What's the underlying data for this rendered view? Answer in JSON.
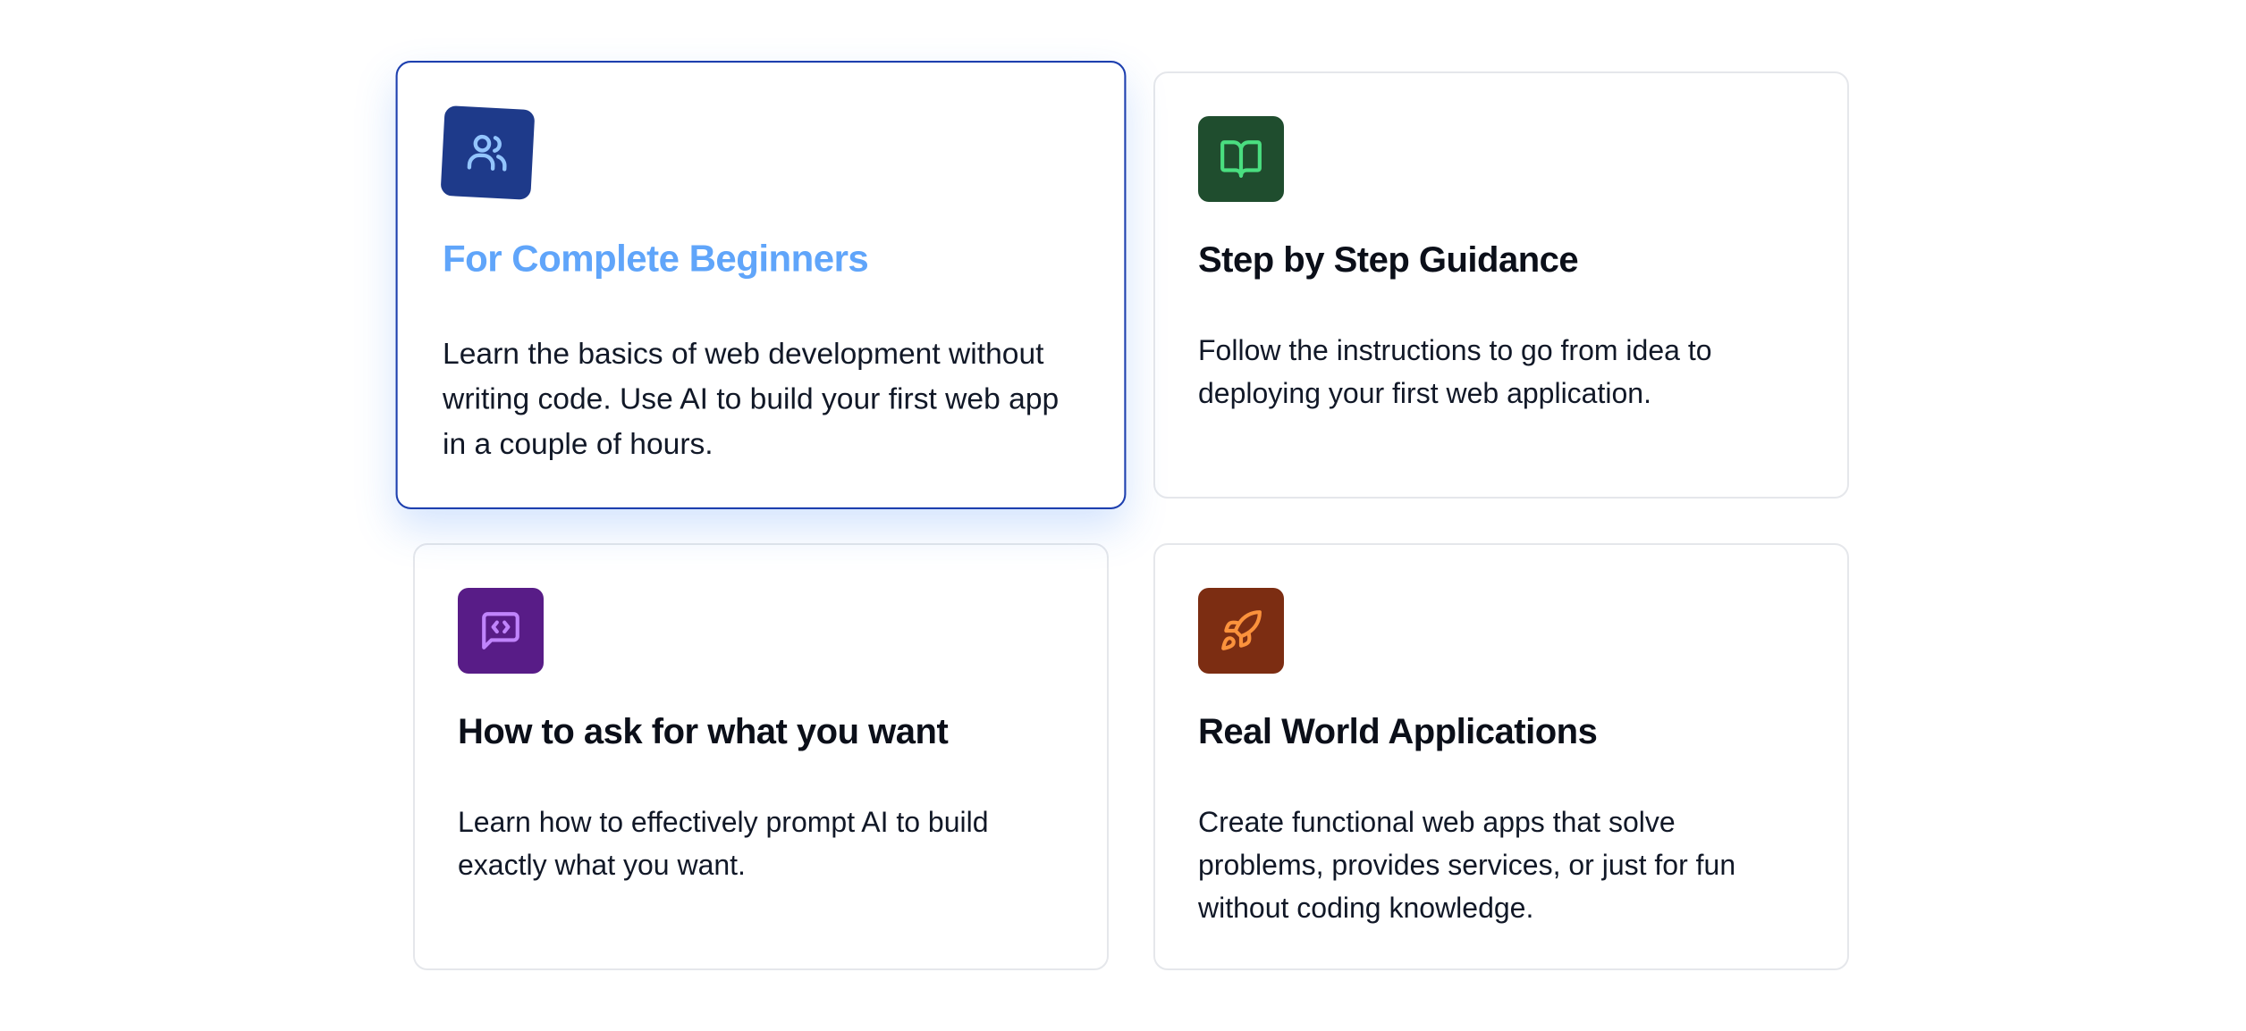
{
  "cards": [
    {
      "title": "For Complete Beginners",
      "description": "Learn the basics of web development without writing code. Use AI to build your first web app in a couple of hours.",
      "icon": "users-icon",
      "icon_bg": "#1e3a8a",
      "icon_color": "#93c5fd",
      "active": true
    },
    {
      "title": "Step by Step Guidance",
      "description": "Follow the instructions to go from idea to deploying your first web application.",
      "icon": "book-open-icon",
      "icon_bg": "#1f4d2e",
      "icon_color": "#4ade80",
      "active": false
    },
    {
      "title": "How to ask for what you want",
      "description": "Learn how to effectively prompt AI to build exactly what you want.",
      "icon": "message-code-icon",
      "icon_bg": "#581c87",
      "icon_color": "#c084fc",
      "active": false
    },
    {
      "title": "Real World Applications",
      "description": "Create functional web apps that solve problems, provides services, or just for fun without coding knowledge.",
      "icon": "rocket-icon",
      "icon_bg": "#7c2d12",
      "icon_color": "#fb923c",
      "active": false
    }
  ],
  "colors": {
    "active_border": "#1e40af",
    "active_title": "#60a5fa",
    "card_border": "#e5e7eb",
    "text": "#111827"
  }
}
